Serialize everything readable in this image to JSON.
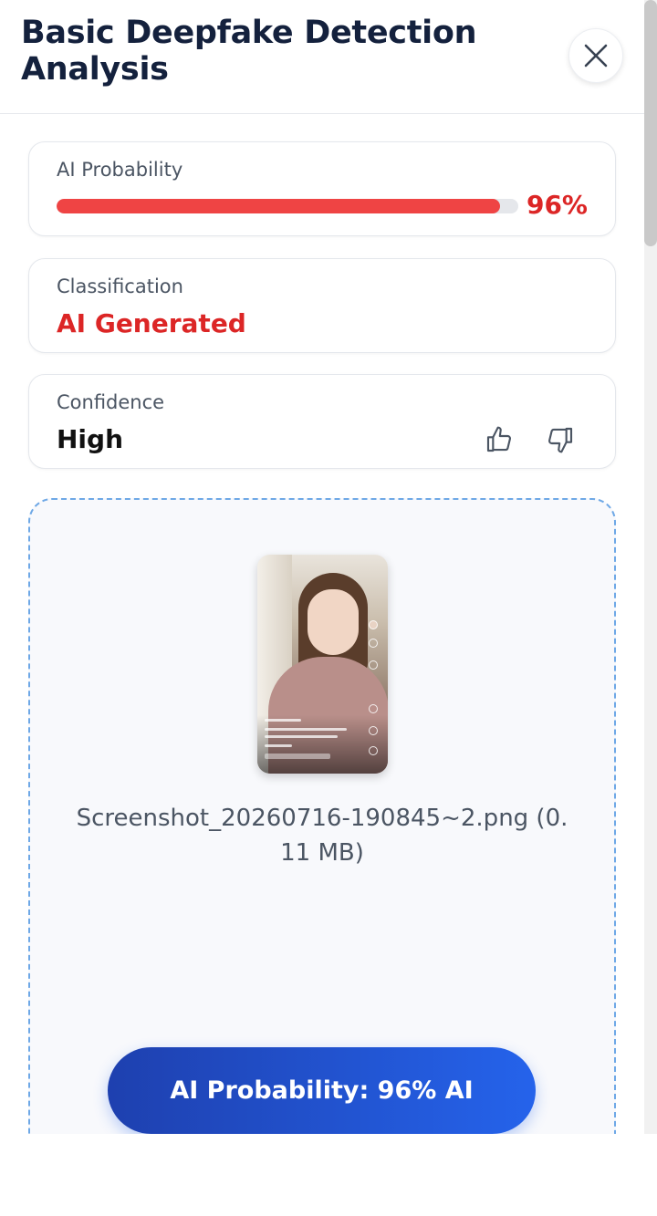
{
  "header": {
    "title": "Basic Deepfake Detection Analysis",
    "close_icon": "close-icon"
  },
  "probability_card": {
    "label": "AI Probability",
    "value_text": "96%",
    "fill_fraction": 0.96,
    "bar_color": "#ef4444"
  },
  "classification_card": {
    "label": "Classification",
    "value": "AI Generated",
    "value_color": "#dc2626"
  },
  "confidence_card": {
    "label": "Confidence",
    "value": "High",
    "feedback_icons": [
      "thumbs-up-icon",
      "thumbs-down-icon"
    ]
  },
  "upload": {
    "filename": "Screenshot_20260716-190845~2.png (0. 11 MB)"
  },
  "cta": {
    "label": "AI Probability: 96% AI",
    "gradient": [
      "#1e40af",
      "#2563eb"
    ]
  }
}
